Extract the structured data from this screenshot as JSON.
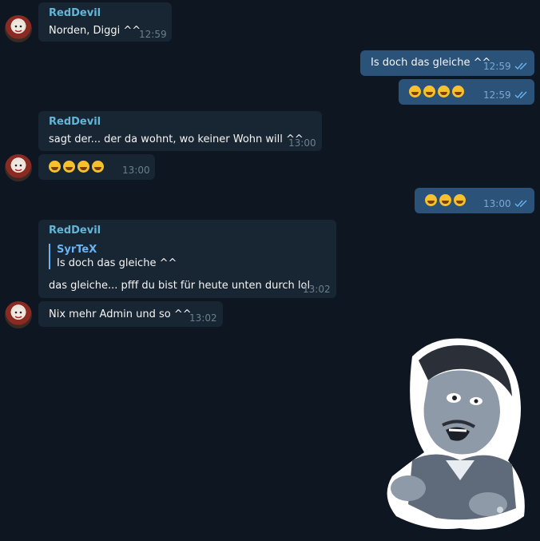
{
  "messages": [
    {
      "sender": "RedDevil",
      "text": "Norden, Diggi  ^^",
      "time": "12:59"
    },
    {
      "text": "Is doch das gleiche ^^",
      "time": "12:59"
    },
    {
      "text": "",
      "time": "12:59",
      "emoji_count": 4,
      "emoji": "rolling-on-floor-laughing"
    },
    {
      "sender": "RedDevil",
      "text": "sagt der... der da wohnt, wo keiner Wohn will  ^^",
      "time": "13:00"
    },
    {
      "text": "",
      "time": "13:00",
      "emoji_count": 4,
      "emoji": "kiss-and-joy"
    },
    {
      "text": "",
      "time": "13:00",
      "emoji_count": 3,
      "emoji": "grinning"
    },
    {
      "sender": "RedDevil",
      "reply_to": {
        "name": "SyrTeX",
        "text": "Is doch das gleiche ^^"
      },
      "text": "das gleiche...  pfff  du bist für heute unten durch   lol",
      "time": "13:02"
    },
    {
      "text": "Nix mehr Admin und so  ^^",
      "time": "13:02"
    }
  ],
  "colors": {
    "background": "#0e1621",
    "incoming": "#182533",
    "outgoing": "#2b5278",
    "accent": "#6ab3f3"
  },
  "icons": {
    "read_receipt": "double-check-icon",
    "avatar": "clown-avatar",
    "sticker": "scared-man-sticker"
  }
}
